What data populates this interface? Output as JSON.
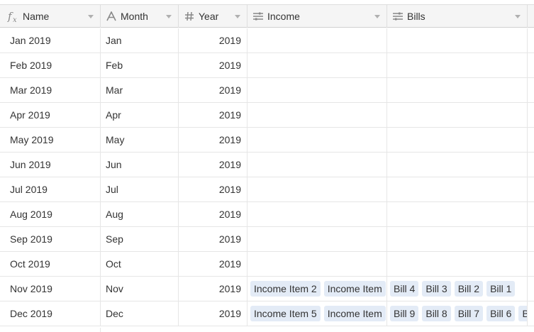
{
  "columns": [
    {
      "label": "Name",
      "icon": "formula-icon"
    },
    {
      "label": "Month",
      "icon": "text-icon"
    },
    {
      "label": "Year",
      "icon": "number-icon"
    },
    {
      "label": "Income",
      "icon": "linked-record-icon"
    },
    {
      "label": "Bills",
      "icon": "linked-record-icon"
    }
  ],
  "rows": [
    {
      "name": "Jan 2019",
      "month": "Jan",
      "year": "2019",
      "income": [],
      "bills": []
    },
    {
      "name": "Feb 2019",
      "month": "Feb",
      "year": "2019",
      "income": [],
      "bills": []
    },
    {
      "name": "Mar 2019",
      "month": "Mar",
      "year": "2019",
      "income": [],
      "bills": []
    },
    {
      "name": "Apr 2019",
      "month": "Apr",
      "year": "2019",
      "income": [],
      "bills": []
    },
    {
      "name": "May 2019",
      "month": "May",
      "year": "2019",
      "income": [],
      "bills": []
    },
    {
      "name": "Jun 2019",
      "month": "Jun",
      "year": "2019",
      "income": [],
      "bills": []
    },
    {
      "name": "Jul 2019",
      "month": "Jul",
      "year": "2019",
      "income": [],
      "bills": []
    },
    {
      "name": "Aug 2019",
      "month": "Aug",
      "year": "2019",
      "income": [],
      "bills": []
    },
    {
      "name": "Sep 2019",
      "month": "Sep",
      "year": "2019",
      "income": [],
      "bills": []
    },
    {
      "name": "Oct 2019",
      "month": "Oct",
      "year": "2019",
      "income": [],
      "bills": []
    },
    {
      "name": "Nov 2019",
      "month": "Nov",
      "year": "2019",
      "income": [
        "Income Item 2",
        "Income Item"
      ],
      "bills": [
        "Bill 4",
        "Bill 3",
        "Bill 2",
        "Bill 1"
      ]
    },
    {
      "name": "Dec 2019",
      "month": "Dec",
      "year": "2019",
      "income": [
        "Income Item 5",
        "Income Item"
      ],
      "bills": [
        "Bill 9",
        "Bill 8",
        "Bill 7",
        "Bill 6",
        "B"
      ]
    }
  ],
  "colors": {
    "header_bg": "#f5f5f5",
    "chip_bg": "#e3ebf6",
    "grid_line": "#e6e6e6",
    "text": "#333333",
    "icon": "#888888"
  }
}
